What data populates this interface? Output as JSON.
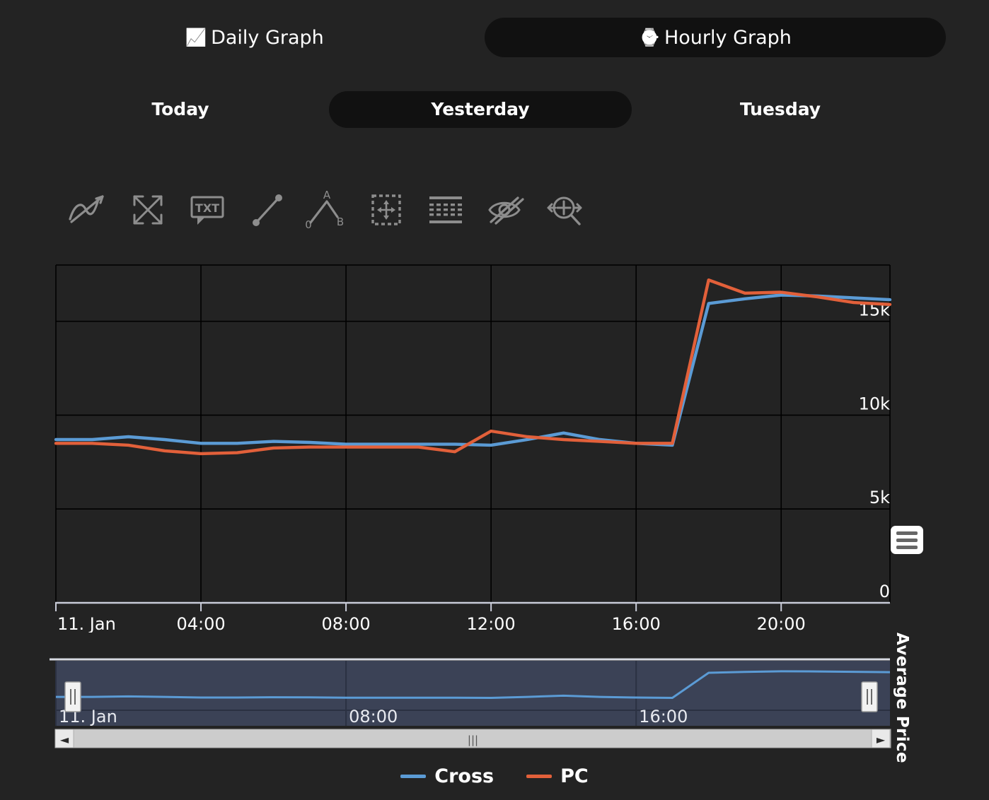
{
  "graph_tabs": [
    {
      "label": "Daily Graph",
      "icon": "line-chart-icon",
      "glyph": "📈",
      "selected": false
    },
    {
      "label": "Hourly Graph",
      "icon": "watch-24h-icon",
      "glyph": "⌚",
      "selected": true
    }
  ],
  "day_tabs": [
    {
      "label": "Today",
      "selected": false
    },
    {
      "label": "Yesterday",
      "selected": true
    },
    {
      "label": "Tuesday",
      "selected": false
    }
  ],
  "toolbar": [
    {
      "name": "indicators-icon",
      "title": "Indicators"
    },
    {
      "name": "fullscreen-icon",
      "title": "Full screen"
    },
    {
      "name": "text-annotation-icon",
      "title": "Text annotation"
    },
    {
      "name": "line-segment-icon",
      "title": "Line segment"
    },
    {
      "name": "angle-measure-icon",
      "title": "Angle measure"
    },
    {
      "name": "crosshair-box-icon",
      "title": "Crosshair"
    },
    {
      "name": "table-grid-icon",
      "title": "Table"
    },
    {
      "name": "hide-eye-icon",
      "title": "Hide annotations"
    },
    {
      "name": "zoom-pan-icon",
      "title": "Zoom / pan"
    }
  ],
  "menu_button": {
    "name": "chart-menu-button",
    "label": "Chart context menu"
  },
  "legend": [
    {
      "label": "Cross",
      "color": "#5b9bd5"
    },
    {
      "label": "PC",
      "color": "#e2603a"
    }
  ],
  "navigator": {
    "xticks": [
      "11. Jan",
      "08:00",
      "16:00"
    ],
    "left_handle": "nav-handle-left",
    "right_handle": "nav-handle-right",
    "scroll_left": "◄",
    "scroll_right": "►",
    "grip": "|||"
  },
  "chart_data": {
    "type": "line",
    "title": "",
    "xlabel": "",
    "ylabel": "Average Price",
    "ylim": [
      0,
      18000
    ],
    "yticks": [
      0,
      5000,
      10000,
      15000
    ],
    "ytick_labels": [
      "0",
      "5k",
      "10k",
      "15k"
    ],
    "grid": true,
    "legend_position": "bottom",
    "x": [
      "11. Jan",
      "01:00",
      "02:00",
      "03:00",
      "04:00",
      "05:00",
      "06:00",
      "07:00",
      "08:00",
      "09:00",
      "10:00",
      "11:00",
      "12:00",
      "13:00",
      "14:00",
      "15:00",
      "16:00",
      "17:00",
      "18:00",
      "19:00",
      "20:00",
      "21:00",
      "22:00",
      "23:00"
    ],
    "xtick_labels": [
      "11. Jan",
      "04:00",
      "08:00",
      "12:00",
      "16:00",
      "20:00"
    ],
    "series": [
      {
        "name": "Cross",
        "color": "#5b9bd5",
        "values": [
          8700,
          8700,
          8850,
          8700,
          8500,
          8500,
          8600,
          8550,
          8450,
          8450,
          8450,
          8450,
          8400,
          8700,
          9050,
          8700,
          8500,
          8400,
          15950,
          16200,
          16400,
          16350,
          16250,
          16150
        ]
      },
      {
        "name": "PC",
        "color": "#e2603a",
        "values": [
          8500,
          8500,
          8400,
          8100,
          7950,
          8000,
          8250,
          8300,
          8300,
          8300,
          8300,
          8050,
          9150,
          8850,
          8700,
          8600,
          8500,
          8500,
          17200,
          16500,
          16550,
          16300,
          16000,
          15900
        ]
      }
    ]
  }
}
